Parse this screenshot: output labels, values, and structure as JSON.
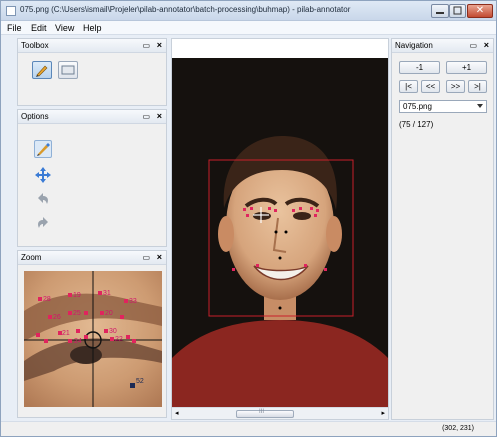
{
  "window": {
    "title": "075.png (C:\\Users\\ismail\\Projeler\\pilab-annotator\\batch-processing\\buhmap) - pilab-annotator"
  },
  "menu": [
    "File",
    "Edit",
    "View",
    "Help"
  ],
  "toolbox": {
    "title": "Toolbox",
    "tools": [
      "pencil-tool",
      "rectangle-tool"
    ]
  },
  "options": {
    "title": "Options",
    "tools": [
      "pen-option",
      "move-option",
      "undo-option",
      "redo-option"
    ]
  },
  "zoom": {
    "title": "Zoom",
    "point_labels": [
      "28",
      "19",
      "31",
      "33",
      "26",
      "25",
      "20",
      "21",
      "30",
      "24",
      "22",
      "52"
    ]
  },
  "navigation": {
    "title": "Navigation",
    "minus_label": "-1",
    "plus_label": "+1",
    "first_label": "|<",
    "prev_label": "<<",
    "next_label": ">>",
    "last_label": ">|",
    "file_select": "075.png",
    "counter": "(75 / 127)"
  },
  "scrollbar": {
    "grip": "III",
    "left_arrow": "◂",
    "right_arrow": "▸"
  },
  "status": {
    "coords": "(302, 231)"
  },
  "colors": {
    "landmark": "#e0245e",
    "accent": "#3a7bd5",
    "box": "#c8202a"
  }
}
